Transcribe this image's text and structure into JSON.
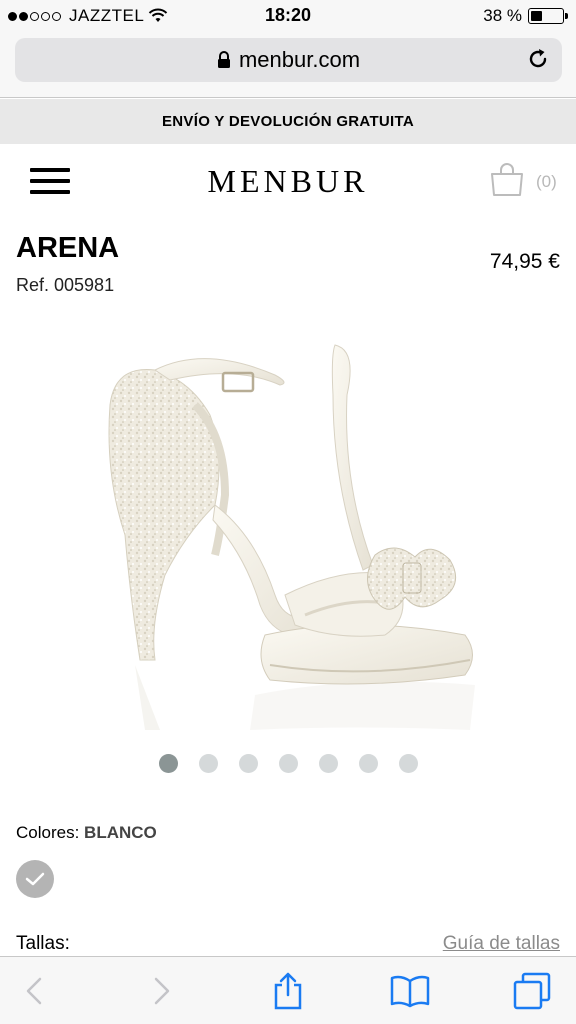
{
  "status_bar": {
    "carrier": "JAZZTEL",
    "time": "18:20",
    "battery": "38 %",
    "battery_level": 0.38
  },
  "browser": {
    "url": "menbur.com"
  },
  "promo": {
    "text": "ENVÍO Y DEVOLUCIÓN GRATUITA"
  },
  "header": {
    "logo": "MENBUR",
    "cart_count": "(0)"
  },
  "product": {
    "name": "ARENA",
    "ref": "Ref. 005981",
    "price": "74,95 €",
    "image_count": 7,
    "active_image": 1
  },
  "colors": {
    "label": "Colores:",
    "selected": "BLANCO"
  },
  "sizes": {
    "label": "Tallas:",
    "guide_link": "Guía de tallas"
  },
  "icons": {
    "menu": "hamburger-icon",
    "cart": "shopping-bag-icon",
    "lock": "lock-icon",
    "reload": "reload-icon",
    "back": "chevron-left-icon",
    "forward": "chevron-right-icon",
    "share": "share-icon",
    "bookmarks": "book-icon",
    "tabs": "tabs-icon"
  },
  "colors_palette": {
    "accent_blue": "#1a7bf2",
    "swatch_gray": "#b4b4b4",
    "muted": "#b8b8b8"
  }
}
